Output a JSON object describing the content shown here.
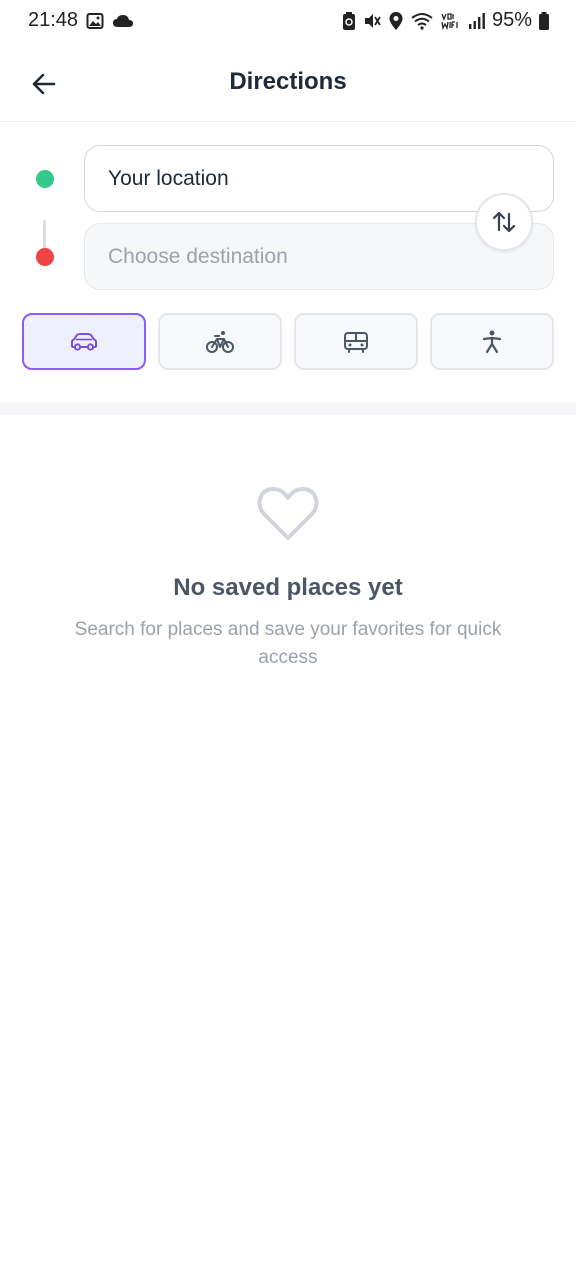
{
  "status_bar": {
    "time": "21:48",
    "battery": "95%",
    "icons": [
      "image-icon",
      "cloud-icon",
      "battery-saver-icon",
      "mute-icon",
      "location-icon",
      "wifi-icon",
      "volte-wifi-icon",
      "signal-icon",
      "battery-icon"
    ]
  },
  "header": {
    "title": "Directions",
    "back_icon": "arrow-left-icon"
  },
  "route": {
    "origin": {
      "value": "Your location",
      "dot_color": "#34c98b"
    },
    "destination": {
      "placeholder": "Choose destination",
      "dot_color": "#ef4444"
    },
    "swap_icon": "swap-vertical-icon"
  },
  "modes": {
    "items": [
      {
        "icon": "car-icon",
        "selected": true
      },
      {
        "icon": "bicycle-icon",
        "selected": false
      },
      {
        "icon": "bus-icon",
        "selected": false
      },
      {
        "icon": "walk-icon",
        "selected": false
      }
    ],
    "accent": "#8b5cf6"
  },
  "empty_state": {
    "icon": "heart-icon",
    "title": "No saved places yet",
    "subtitle": "Search for places and save your favorites for quick access"
  }
}
